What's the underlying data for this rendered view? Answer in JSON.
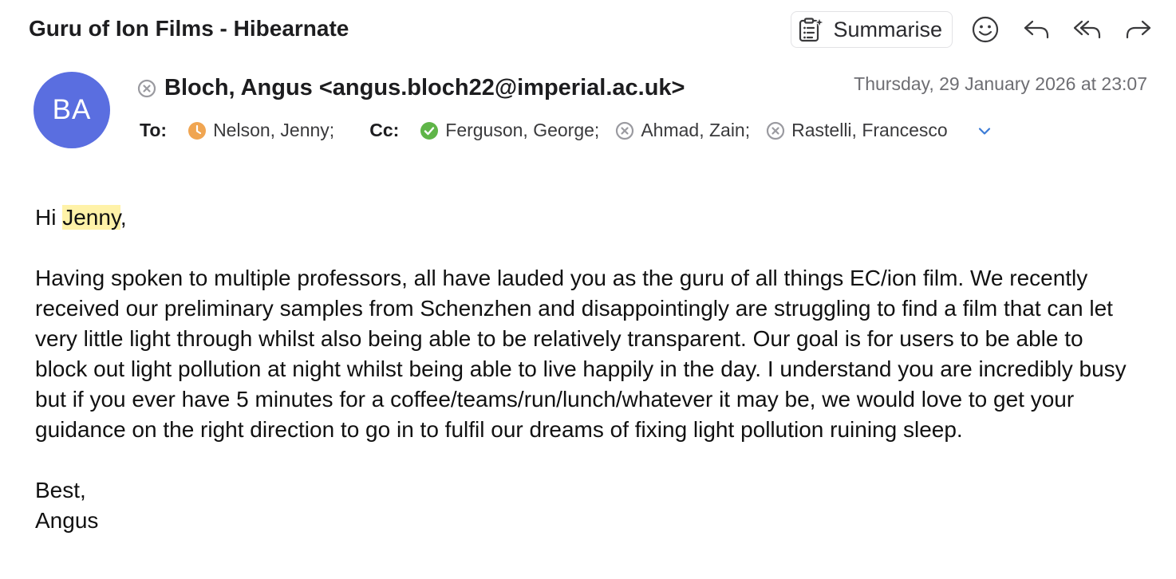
{
  "subject": "Guru of Ion Films - Hibearnate",
  "toolbar": {
    "summarise_label": "Summarise",
    "icons": [
      "summarise-icon",
      "emoji-icon",
      "reply-icon",
      "reply-all-icon",
      "forward-icon"
    ]
  },
  "sender": {
    "initials": "BA",
    "display": "Bloch, Angus <angus.bloch22@imperial.ac.uk>",
    "avatar_color": "#5a6ee0"
  },
  "date": "Thursday, 29 January 2026 at 23:07",
  "recipients": {
    "to_label": "To:",
    "cc_label": "Cc:",
    "to": [
      {
        "name": "Nelson, Jenny;",
        "status": "clock-icon",
        "status_color": "#f0a551"
      }
    ],
    "cc": [
      {
        "name": "Ferguson, George;",
        "status": "check-icon",
        "status_color": "#5fb548"
      },
      {
        "name": "Ahmad, Zain;",
        "status": "unavailable-icon",
        "status_color": "#9a9aa0"
      },
      {
        "name": "Rastelli, Francesco",
        "status": "unavailable-icon",
        "status_color": "#9a9aa0"
      }
    ]
  },
  "body": {
    "greeting_prefix": "Hi ",
    "greeting_name": "Jenny",
    "greeting_suffix": ",",
    "paragraph": "Having spoken to multiple professors, all have lauded you as the guru of all things EC/ion film. We recently received our preliminary samples from Schenzhen and disappointingly are struggling to find a film that can let very little light through whilst also being able to be relatively transparent. Our goal is for users to be able to block out light pollution at night whilst being able to live happily in the day. I understand you are incredibly busy but if you ever have 5 minutes for a coffee/teams/run/lunch/whatever it may be, we would love to get your guidance on the right direction to go in to fulfil our dreams of fixing light pollution ruining sleep.",
    "signoff": "Best,",
    "signature": "Angus"
  },
  "colors": {
    "highlight": "#fff2a8",
    "accent_chevron": "#3b7bd6"
  }
}
